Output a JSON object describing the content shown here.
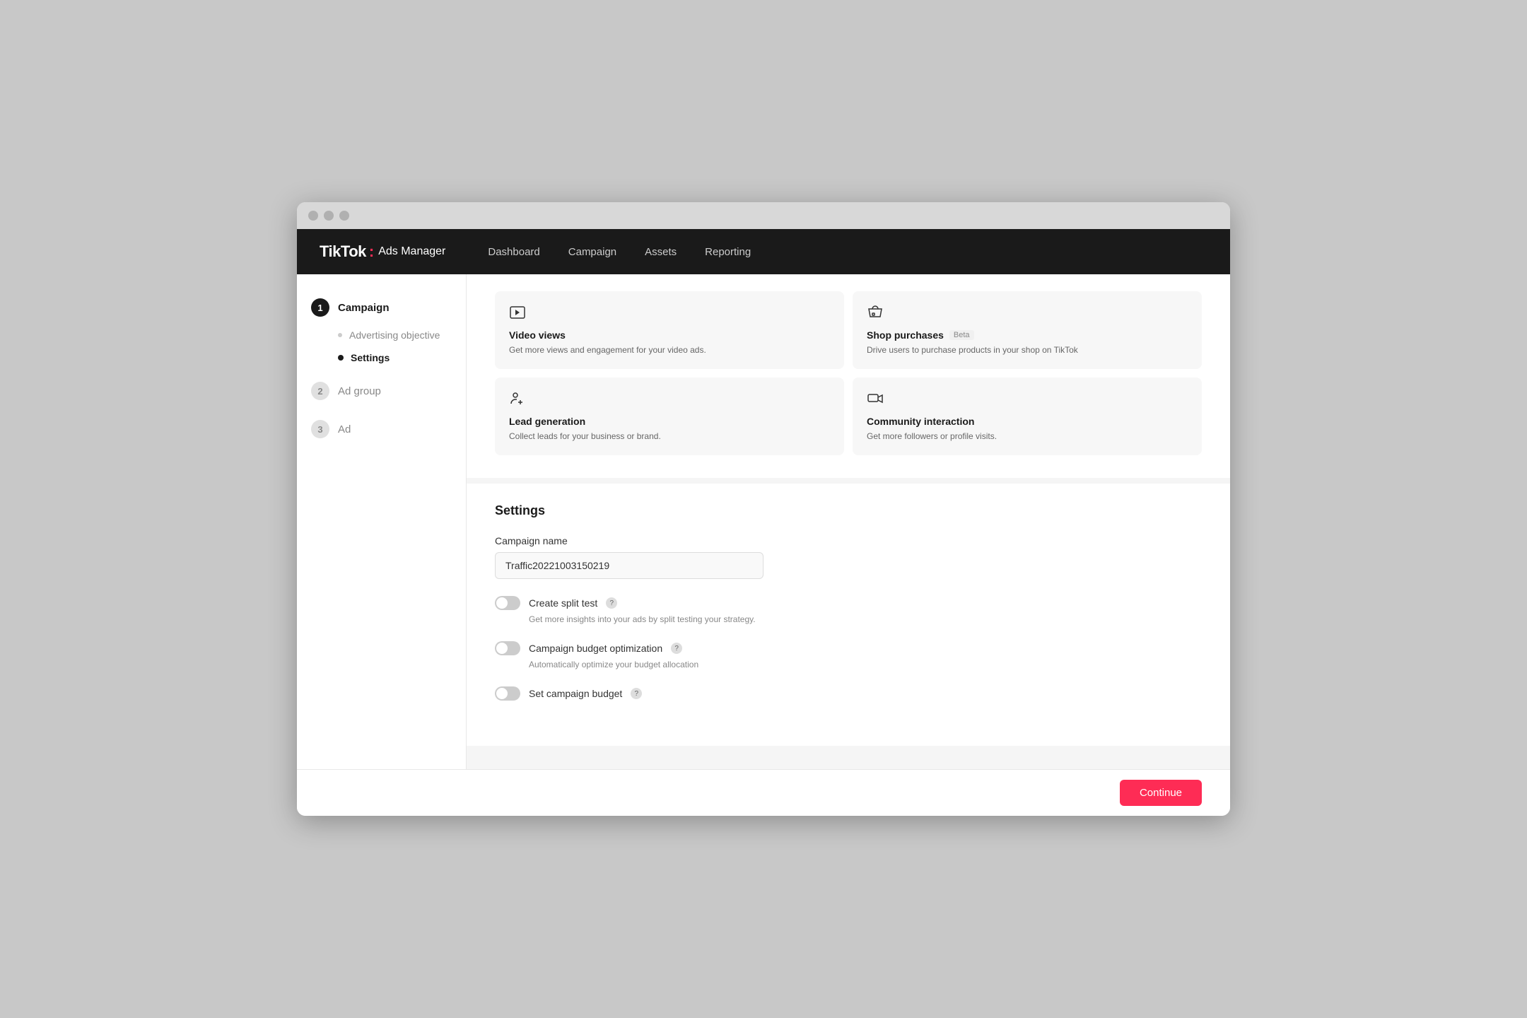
{
  "browser": {
    "dots": [
      "dot1",
      "dot2",
      "dot3"
    ]
  },
  "nav": {
    "logo_tiktok": "TikTok",
    "logo_colon": ":",
    "logo_ads": "Ads Manager",
    "items": [
      {
        "id": "dashboard",
        "label": "Dashboard"
      },
      {
        "id": "campaign",
        "label": "Campaign"
      },
      {
        "id": "assets",
        "label": "Assets"
      },
      {
        "id": "reporting",
        "label": "Reporting"
      }
    ]
  },
  "sidebar": {
    "step1_number": "1",
    "step1_label": "Campaign",
    "sub_advertising": "Advertising objective",
    "sub_settings": "Settings",
    "step2_number": "2",
    "step2_label": "Ad group",
    "step3_number": "3",
    "step3_label": "Ad"
  },
  "objectives": {
    "cards": [
      {
        "id": "video-views",
        "title": "Video views",
        "desc": "Get more views and engagement for your video ads."
      },
      {
        "id": "shop-purchases",
        "title": "Shop purchases",
        "beta": "Beta",
        "desc": "Drive users to purchase products in your shop on TikTok"
      },
      {
        "id": "lead-generation",
        "title": "Lead generation",
        "desc": "Collect leads for your business or brand."
      },
      {
        "id": "community-interaction",
        "title": "Community interaction",
        "desc": "Get more followers or profile visits."
      }
    ]
  },
  "settings": {
    "title": "Settings",
    "campaign_name_label": "Campaign name",
    "campaign_name_value": "Traffic20221003150219",
    "campaign_name_placeholder": "Campaign name",
    "toggles": [
      {
        "id": "split-test",
        "label": "Create split test",
        "desc": "Get more insights into your ads by split testing your strategy.",
        "on": false
      },
      {
        "id": "budget-optimization",
        "label": "Campaign budget optimization",
        "desc": "Automatically optimize your budget allocation",
        "on": false
      },
      {
        "id": "set-budget",
        "label": "Set campaign budget",
        "desc": "",
        "on": false
      }
    ]
  },
  "footer": {
    "continue_label": "Continue"
  }
}
